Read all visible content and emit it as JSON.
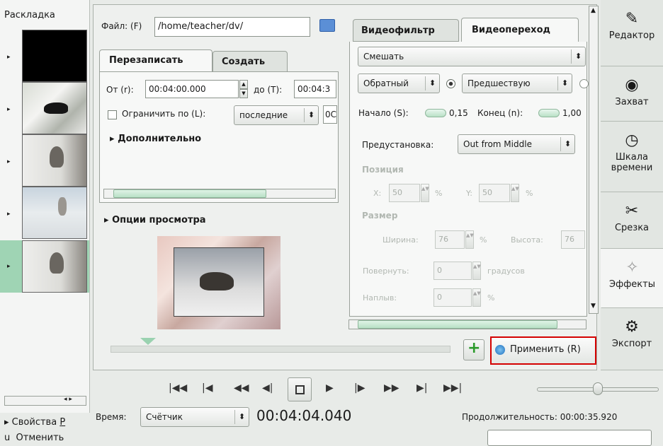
{
  "left": {
    "header": "Раскладка",
    "prop_label": "Свойства",
    "prop_key": "P",
    "undo_prefix": "u",
    "undo_label": "Отменить"
  },
  "file": {
    "label": "Файл:",
    "key": "(F)",
    "value": "/home/teacher/dv/"
  },
  "tabs": {
    "overwrite": "Перезаписать",
    "create": "Создать"
  },
  "range": {
    "from_label": "От",
    "from_key": "(r):",
    "from_value": "00:04:00.000",
    "to_label": "до",
    "to_key": "(T):",
    "to_value": "00:04:3"
  },
  "limit": {
    "label": "Ограничить по",
    "key": "(L):",
    "combo": "последние",
    "value": "0C"
  },
  "advanced": "Дополнительно",
  "preview_options": "Опции просмотра",
  "right_tabs": {
    "filter": "Видеофильтр",
    "transition": "Видеопереход"
  },
  "transition": {
    "mix": "Смешать",
    "reverse": "Обратный",
    "previous": "Предшествую",
    "start_label": "Начало",
    "start_key": "(S):",
    "start_value": "0,15",
    "end_label": "Конец",
    "end_key": "(n):",
    "end_value": "1,00",
    "preset_label": "Предустановка:",
    "preset_value": "Out from Middle",
    "position": "Позиция",
    "x_label": "X:",
    "x_value": "50",
    "y_label": "Y:",
    "y_value": "50",
    "pct": "%",
    "size": "Размер",
    "width_label": "Ширина:",
    "width_value": "76",
    "height_label": "Высота:",
    "height_value": "76",
    "rotate_label": "Повернуть:",
    "rotate_value": "0",
    "degrees": "градусов",
    "fade_label": "Наплыв:",
    "fade_value": "0"
  },
  "apply": {
    "label": "Применить",
    "key": "(R)"
  },
  "sidebar": [
    {
      "label": "Редактор"
    },
    {
      "label": "Захват"
    },
    {
      "label": "Шкала времени"
    },
    {
      "label": "Срезка"
    },
    {
      "label": "Эффекты"
    },
    {
      "label": "Экспорт"
    }
  ],
  "transport": {
    "time_label": "Время:",
    "counter": "Счётчик",
    "timecode": "00:04:04.040",
    "duration": "Продолжительность: 00:00:35.920"
  },
  "colors": {
    "accent_red": "#d40000",
    "selected_row": "#9fd4b4"
  }
}
